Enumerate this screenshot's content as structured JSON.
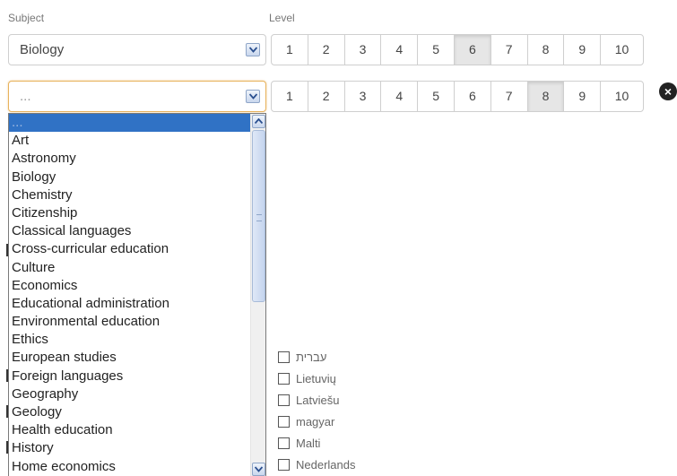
{
  "labels": {
    "subject": "Subject",
    "level": "Level"
  },
  "row1": {
    "subject_value": "Biology",
    "active_level": "6"
  },
  "row2": {
    "subject_value": "...",
    "active_level": "8"
  },
  "levels": [
    "1",
    "2",
    "3",
    "4",
    "5",
    "6",
    "7",
    "8",
    "9",
    "10"
  ],
  "remove_icon": "close-circle-icon",
  "dropdown": {
    "items": [
      "...",
      "Art",
      "Astronomy",
      "Biology",
      "Chemistry",
      "Citizenship",
      "Classical languages",
      "Cross-curricular education",
      "Culture",
      "Economics",
      "Educational administration",
      "Environmental education",
      "Ethics",
      "European studies",
      "Foreign languages",
      "Geography",
      "Geology",
      "Health education",
      "History",
      "Home economics"
    ],
    "selected_index": 0
  },
  "languages": [
    "עברית",
    "Lietuvių",
    "Latviešu",
    "magyar",
    "Malti",
    "Nederlands"
  ],
  "colors": {
    "selected_bg": "#3072c5",
    "focus_border": "#e8b25c",
    "active_level_bg": "#e6e6e6"
  }
}
